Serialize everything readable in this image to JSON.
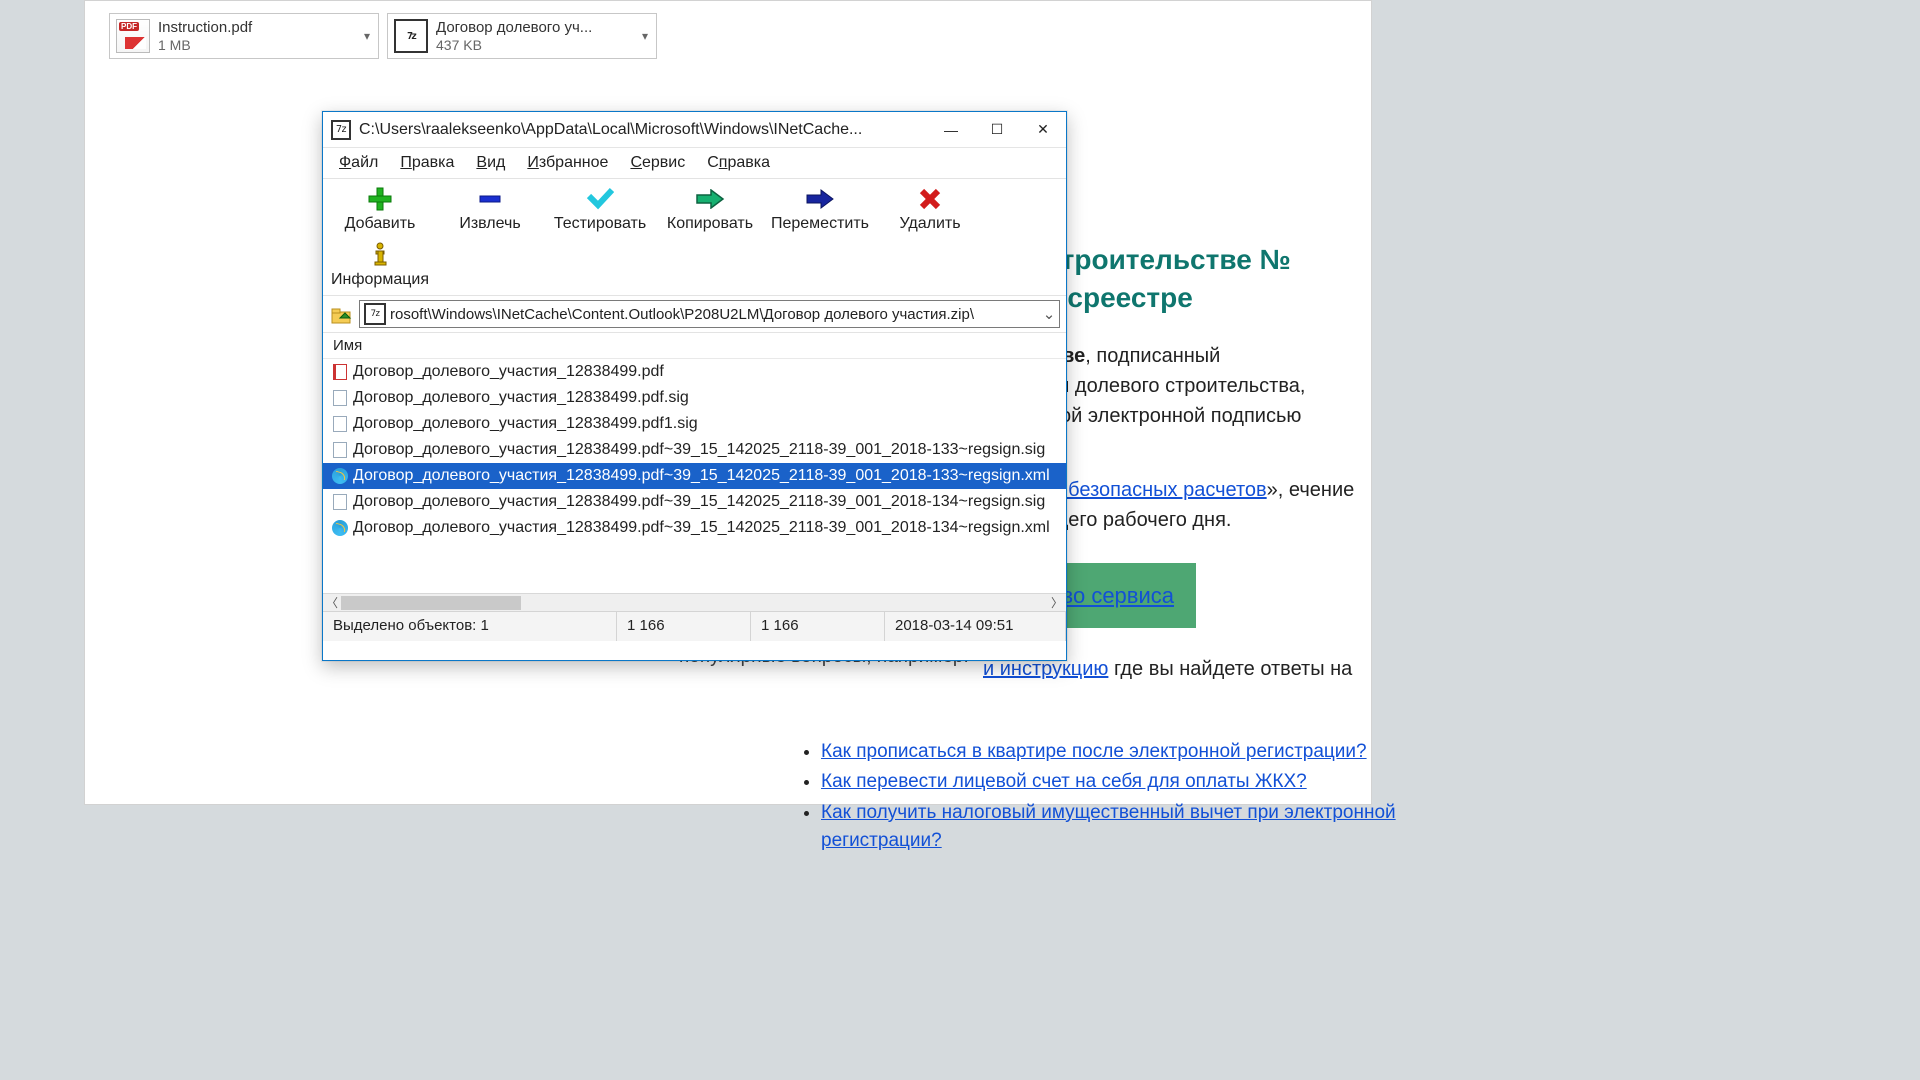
{
  "attachments": [
    {
      "name": "Instruction.pdf",
      "size": "1 MB",
      "type": "pdf"
    },
    {
      "name": "Договор долевого уч...",
      "size": "437 KB",
      "type": "zip"
    }
  ],
  "email": {
    "heading_frag1": "вом строительстве №",
    "heading_frag2": "н в Росреестре",
    "para1_frag1": "ительстве",
    "para1_frag2": ", подписанный",
    "para1_frag3": "астником долевого строительства,",
    "para1_frag4": "ированной электронной подписью",
    "link_service": "Сервис безопасных расчетов",
    "after_link": "», ечение следующего рабочего дня.",
    "green_button": "ачество сервиса",
    "instr_link": "и инструкцию",
    "instr_tail": " где вы найдете ответы на",
    "behind_text": "популярные вопросы, например.",
    "faq": [
      "Как прописаться в квартире после электронной регистрации?",
      "Как перевести лицевой счет на себя для оплаты ЖКХ?",
      "Как получить налоговый имущественный вычет при электронной регистрации?"
    ]
  },
  "win": {
    "title": "C:\\Users\\raalekseenko\\AppData\\Local\\Microsoft\\Windows\\INetCache...",
    "app_icon_text": "7z",
    "menu": {
      "file": "Файл",
      "edit": "Правка",
      "view": "Вид",
      "fav": "Избранное",
      "tools": "Сервис",
      "help": "Справка"
    },
    "toolbar": {
      "add": "Добавить",
      "extract": "Извлечь",
      "test": "Тестировать",
      "copy": "Копировать",
      "move": "Переместить",
      "delete": "Удалить",
      "info": "Информация"
    },
    "address": "rosoft\\Windows\\INetCache\\Content.Outlook\\P208U2LM\\Договор долевого участия.zip\\",
    "col_name": "Имя",
    "files": [
      {
        "icon": "pdf",
        "name": "Договор_долевого_участия_12838499.pdf"
      },
      {
        "icon": "sig",
        "name": "Договор_долевого_участия_12838499.pdf.sig"
      },
      {
        "icon": "sig",
        "name": "Договор_долевого_участия_12838499.pdf1.sig"
      },
      {
        "icon": "sig",
        "name": "Договор_долевого_участия_12838499.pdf~39_15_142025_2118-39_001_2018-133~regsign.sig"
      },
      {
        "icon": "xml",
        "name": "Договор_долевого_участия_12838499.pdf~39_15_142025_2118-39_001_2018-133~regsign.xml",
        "selected": true
      },
      {
        "icon": "sig",
        "name": "Договор_долевого_участия_12838499.pdf~39_15_142025_2118-39_001_2018-134~regsign.sig"
      },
      {
        "icon": "xml",
        "name": "Договор_долевого_участия_12838499.pdf~39_15_142025_2118-39_001_2018-134~regsign.xml"
      }
    ],
    "status": {
      "sel": "Выделено объектов: 1",
      "s1": "1 166",
      "s2": "1 166",
      "date": "2018-03-14 09:51"
    }
  }
}
